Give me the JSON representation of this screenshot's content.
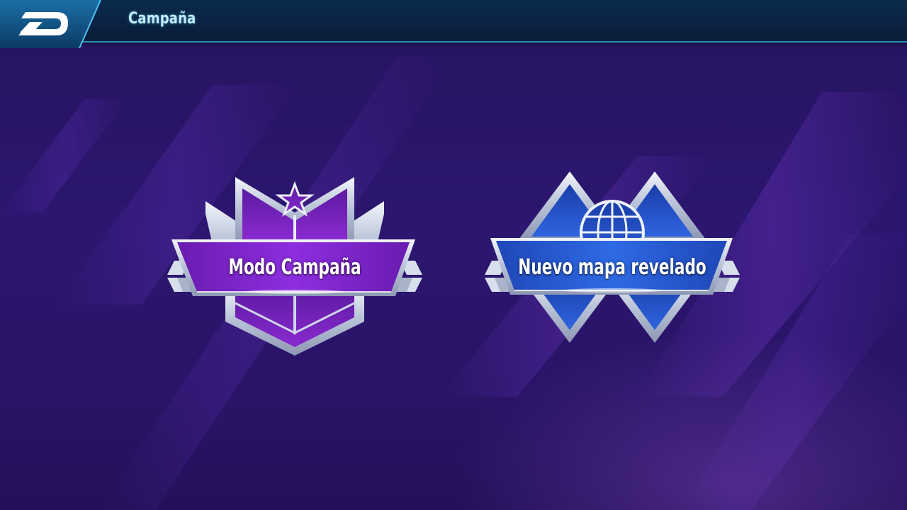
{
  "header": {
    "title": "Campaña",
    "back_icon": "back-arrow-icon"
  },
  "modes": [
    {
      "label": "Modo Campaña",
      "icon": "star-icon",
      "color": "#7a1fc0"
    },
    {
      "label": "Nuevo mapa revelado",
      "icon": "globe-icon",
      "color": "#1e4fc8"
    }
  ],
  "colors": {
    "background": "#2a1466",
    "header": "#0b2242",
    "header_accent": "#2a8fc0",
    "title_text": "#bfeaf6",
    "badge_silver": "#c9d3e6"
  }
}
